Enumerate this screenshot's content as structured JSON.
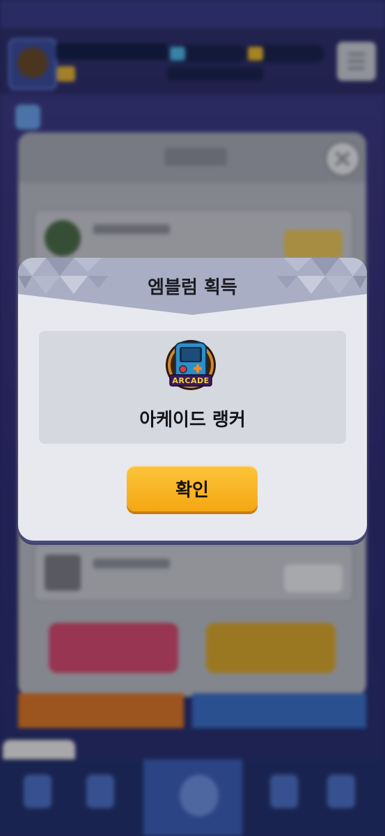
{
  "modal": {
    "title": "엠블럼 획득",
    "emblem": {
      "icon": "arcade-emblem-icon",
      "badge_text": "ARCADE",
      "name": "아케이드 랭커"
    },
    "confirm_label": "확인"
  },
  "colors": {
    "header": "#a9aec4",
    "dialog": "#e8e9ef",
    "reward_box": "#d6d8df",
    "button": "#f5a713"
  }
}
